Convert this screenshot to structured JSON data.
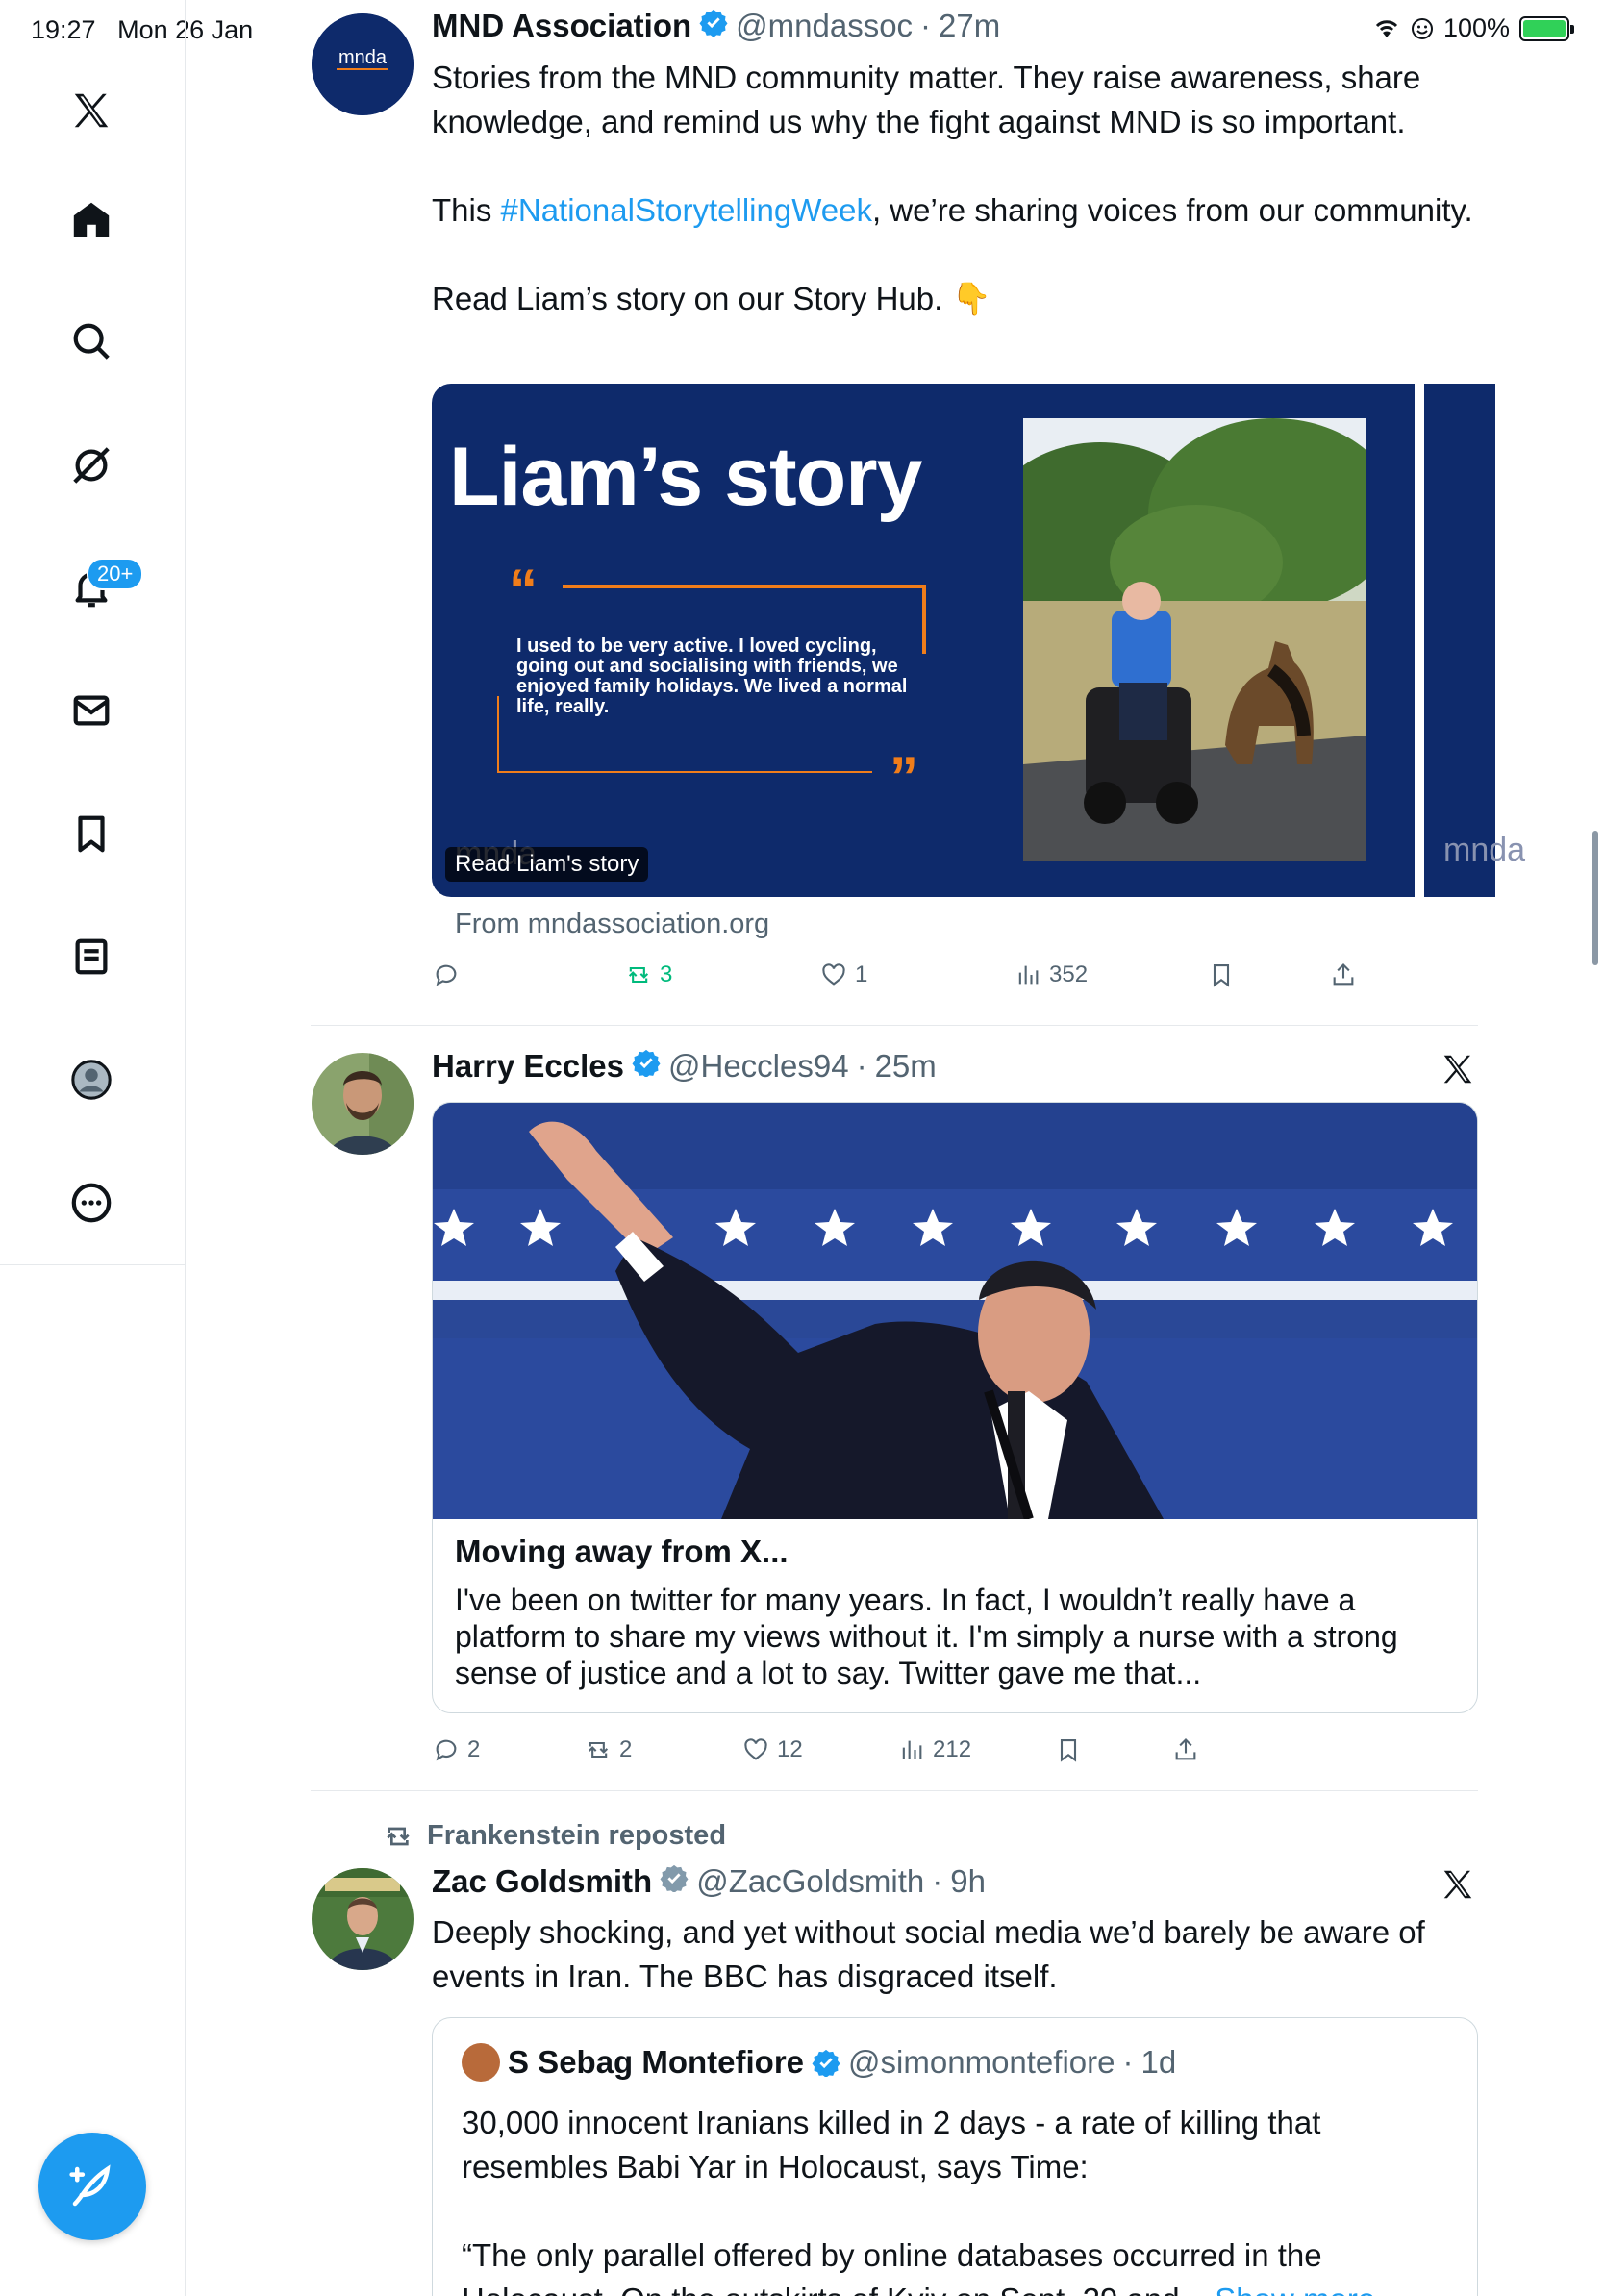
{
  "status_bar": {
    "time": "19:27",
    "date": "Mon 26 Jan",
    "battery": "100%",
    "battery_level": 1.0
  },
  "sidebar": {
    "notifications_badge": "20+"
  },
  "posts": [
    {
      "author": "MND Association",
      "handle": "@mndassoc",
      "time": "27m",
      "text_1": "Stories from the MND community matter. They raise awareness, share knowledge, and remind us why the fight against MND is so important.",
      "text_2_before": "This ",
      "hashtag": "#NationalStorytellingWeek",
      "text_2_after": ", we’re sharing voices from our community.",
      "text_3": "Read Liam’s story on our Story Hub. 👇",
      "avatar_text": "mnda",
      "card": {
        "title": "Liam’s story",
        "quote": "I used to be very active. I loved cycling, going out and socialising with friends, we enjoyed family holidays. We lived a normal life, really.",
        "caption": "Read Liam's story",
        "mark": "mnda",
        "source": "From mndassociation.org"
      },
      "actions": {
        "replies": "",
        "reposts": "3",
        "likes": "1",
        "views": "352"
      }
    },
    {
      "author": "Harry Eccles",
      "handle": "@Heccles94",
      "time": "25m",
      "article": {
        "title": "Moving away from X...",
        "body": "I've been on twitter for many years. In fact, I wouldn’t really have a platform to share my views without it. I'm simply a nurse with a strong sense of justice and a lot to say. Twitter gave me that..."
      },
      "actions": {
        "replies": "2",
        "reposts": "2",
        "likes": "12",
        "views": "212"
      }
    },
    {
      "reposted_by": "Frankenstein reposted",
      "author": "Zac Goldsmith",
      "handle": "@ZacGoldsmith",
      "time": "9h",
      "text": "Deeply shocking, and yet without social media we’d barely be aware of events in Iran. The BBC has disgraced itself.",
      "quote": {
        "author": "S Sebag Montefiore",
        "handle": "@simonmontefiore",
        "time": "1d",
        "text_1": "30,000 innocent Iranians killed in 2 days - a rate of killing that resembles Babi Yar in Holocaust, says Time:",
        "text_2": "“The only parallel offered by online databases occurred in the Holocaust. On the outskirts of Kyiv on Sept. 29 and...",
        "show_more": "Show more"
      }
    }
  ],
  "colors": {
    "accent": "#1d9bf0",
    "mnd_navy": "#0e2a6b",
    "mnd_orange": "#f07d1a",
    "repost_green": "#00ba7c"
  }
}
